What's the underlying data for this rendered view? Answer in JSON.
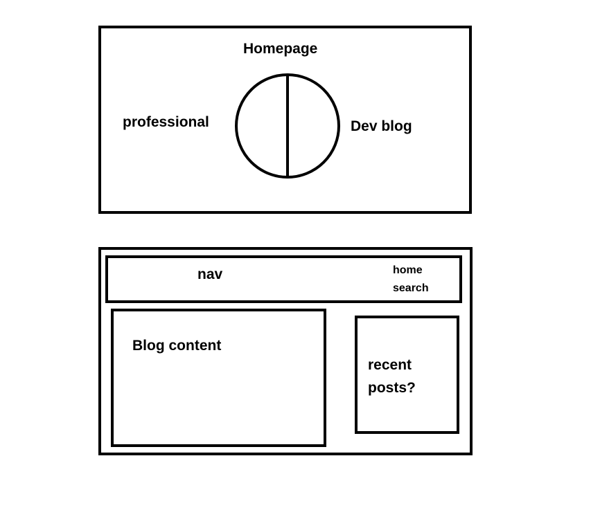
{
  "homepage": {
    "title": "Homepage",
    "left_label": "professional",
    "right_label": "Dev blog"
  },
  "blog_layout": {
    "nav": {
      "label": "nav",
      "links": [
        "home",
        "search"
      ]
    },
    "main_label": "Blog content",
    "sidebar_label_line1": "recent",
    "sidebar_label_line2": "posts?"
  }
}
